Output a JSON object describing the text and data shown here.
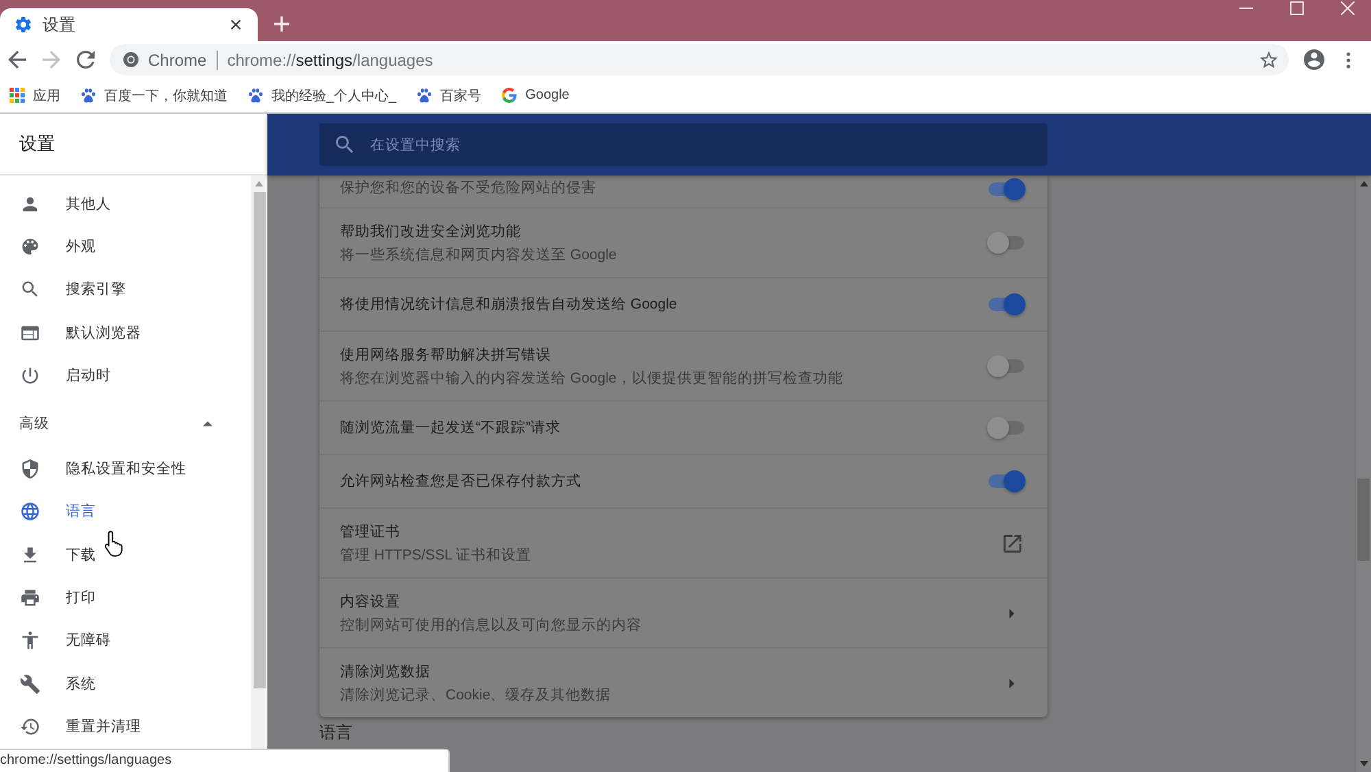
{
  "tabs": [
    {
      "title": "设置",
      "selected": true
    }
  ],
  "toolbar": {
    "back_disabled": false,
    "forward_disabled": true,
    "site_label": "Chrome",
    "url": "chrome://**settings**/languages",
    "starred": false
  },
  "bookmarks": [
    {
      "kind": "apps",
      "label": "应用"
    },
    {
      "kind": "paw",
      "label": "百度一下，你就知道"
    },
    {
      "kind": "paw",
      "label": "我的经验_个人中心_"
    },
    {
      "kind": "paw",
      "label": "百家号"
    },
    {
      "kind": "google",
      "label": "Google"
    }
  ],
  "sidebar": {
    "title": "设置",
    "items": [
      {
        "kind": "item",
        "label": "其他人",
        "selected": false
      },
      {
        "kind": "item",
        "label": "外观",
        "selected": false
      },
      {
        "kind": "item",
        "label": "搜索引擎",
        "selected": false
      },
      {
        "kind": "item",
        "label": "默认浏览器",
        "selected": false
      },
      {
        "kind": "item",
        "label": "启动时",
        "selected": false
      },
      {
        "kind": "section",
        "label": "高级",
        "expanded": true
      },
      {
        "kind": "item",
        "label": "隐私设置和安全性",
        "selected": false
      },
      {
        "kind": "item",
        "label": "语言",
        "selected": true
      },
      {
        "kind": "item",
        "label": "下载",
        "selected": false
      },
      {
        "kind": "item",
        "label": "打印",
        "selected": false
      },
      {
        "kind": "item",
        "label": "无障碍",
        "selected": false
      },
      {
        "kind": "item",
        "label": "系统",
        "selected": false
      },
      {
        "kind": "item",
        "label": "重置并清理",
        "selected": false
      }
    ]
  },
  "main": {
    "search": {
      "placeholder": "在设置中搜索"
    },
    "rows": [
      {
        "kind": "toggle",
        "description": "保护您和您的设备不受危险网站的侵害",
        "on": true
      },
      {
        "kind": "toggle",
        "title": "帮助我们改进安全浏览功能",
        "description": "将一些系统信息和网页内容发送至 Google",
        "on": false
      },
      {
        "kind": "toggle",
        "title": "将使用情况统计信息和崩溃报告自动发送给 Google",
        "on": true
      },
      {
        "kind": "toggle",
        "title": "使用网络服务帮助解决拼写错误",
        "description": "将您在浏览器中输入的内容发送给 Google，以便提供更智能的拼写检查功能",
        "on": false
      },
      {
        "kind": "toggle",
        "title": "随浏览流量一起发送“不跟踪”请求",
        "on": false
      },
      {
        "kind": "toggle",
        "title": "允许网站检查您是否已保存付款方式",
        "on": true
      },
      {
        "kind": "external",
        "title": "管理证书",
        "description": "管理 HTTPS/SSL 证书和设置"
      },
      {
        "kind": "submenu",
        "title": "内容设置",
        "description": "控制网站可使用的信息以及可向您显示的内容"
      },
      {
        "kind": "submenu",
        "title": "清除浏览数据",
        "description": "清除浏览记录、Cookie、缓存及其他数据"
      }
    ],
    "next_section": "语言"
  },
  "status_bubble": "chrome://settings/languages"
}
